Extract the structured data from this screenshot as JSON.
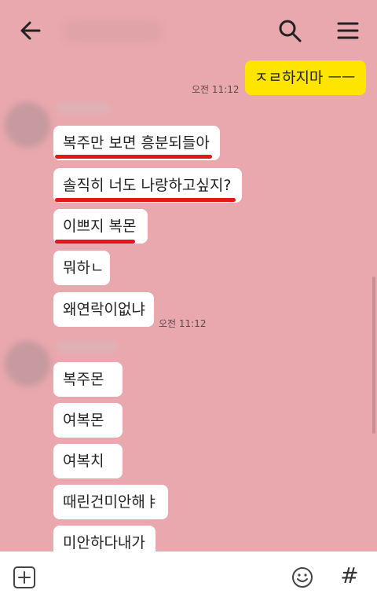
{
  "header": {
    "back_icon": "arrow-left-icon",
    "search_icon": "search-icon",
    "menu_icon": "hamburger-menu-icon"
  },
  "messages_me": [
    {
      "text": "ㅈㄹ하지마 ㅡㅡ",
      "time": "오전 11:12"
    }
  ],
  "group1": {
    "messages": [
      "복주만 보면 흥분되들아",
      "솔직히 너도 나랑하고싶지?",
      "이쁘지 복몬",
      "뭐하ㄴ",
      "왜연락이없냐"
    ],
    "time": "오전 11:12"
  },
  "group2": {
    "messages": [
      "복주몬",
      "여복몬",
      "여복치",
      "때린건미안해ㅑ",
      "미안하다내가"
    ]
  },
  "input_bar": {
    "plus_icon": "plus-icon",
    "emoji_icon": "emoji-icon",
    "hash_label": "#"
  },
  "colors": {
    "background": "#e9a8ae",
    "my_bubble": "#fee500",
    "underline": "#e01818"
  }
}
